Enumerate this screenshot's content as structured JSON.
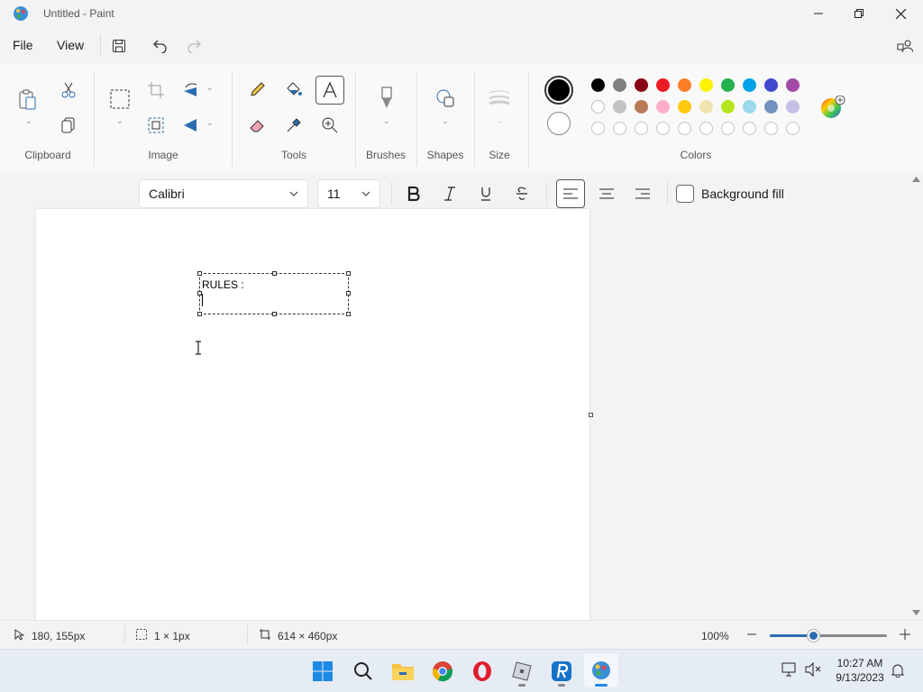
{
  "window": {
    "title": "Untitled - Paint",
    "minimize_icon": "minimize-icon",
    "restore_icon": "restore-icon",
    "close_icon": "close-icon"
  },
  "menu": {
    "file": "File",
    "view": "View"
  },
  "ribbon": {
    "groups": {
      "clipboard": "Clipboard",
      "image": "Image",
      "tools": "Tools",
      "brushes": "Brushes",
      "shapes": "Shapes",
      "size": "Size",
      "colors": "Colors"
    },
    "active_tool": "text",
    "primary_color": "#000000",
    "secondary_color": "#ffffff",
    "palette_row1": [
      "#000000",
      "#7f7f7f",
      "#880015",
      "#ed1c24",
      "#ff7f27",
      "#fff200",
      "#22b14c",
      "#00a2e8",
      "#3f48cc",
      "#a349a4"
    ],
    "palette_row2": [
      "#ffffff",
      "#c3c3c3",
      "#b97a57",
      "#ffaec9",
      "#ffc90e",
      "#efe4b0",
      "#b5e61d",
      "#99d9ea",
      "#7092be",
      "#c8bfe7"
    ],
    "palette_row3_empty_count": 10
  },
  "text_toolbar": {
    "font": "Calibri",
    "size": "11",
    "background_fill_label": "Background fill",
    "background_fill_checked": false,
    "alignment": "left"
  },
  "canvas": {
    "text": "RULES :"
  },
  "status": {
    "cursor_pos": "180, 155px",
    "selection_size": "1 × 1px",
    "canvas_size": "614 × 460px",
    "zoom": "100%",
    "zoom_level": 0.37
  },
  "taskbar": {
    "apps": [
      "start-icon",
      "search-icon",
      "file-explorer-icon",
      "chrome-icon",
      "opera-icon",
      "roblox-icon",
      "r-app-icon",
      "paint-icon"
    ],
    "time": "10:27 AM",
    "date": "9/13/2023"
  }
}
